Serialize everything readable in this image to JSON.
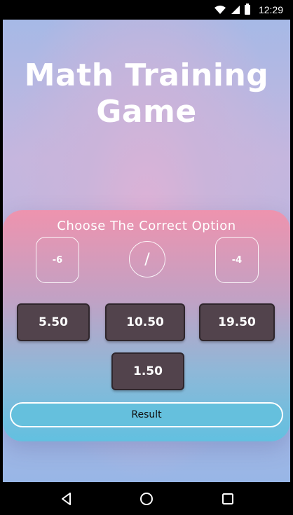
{
  "status_bar": {
    "time": "12:29"
  },
  "title_lines": [
    "Math Training",
    "Game"
  ],
  "card": {
    "prompt": "Choose The Correct Option",
    "operand_left": "-6",
    "operator": "/",
    "operand_right": "-4"
  },
  "options": [
    "5.50",
    "10.50",
    "19.50",
    "1.50"
  ],
  "result_label": "Result",
  "icons": {
    "wifi": "wifi-icon",
    "signal": "signal-icon",
    "battery": "battery-icon",
    "back": "back-icon",
    "home": "home-icon",
    "recents": "recents-icon"
  }
}
